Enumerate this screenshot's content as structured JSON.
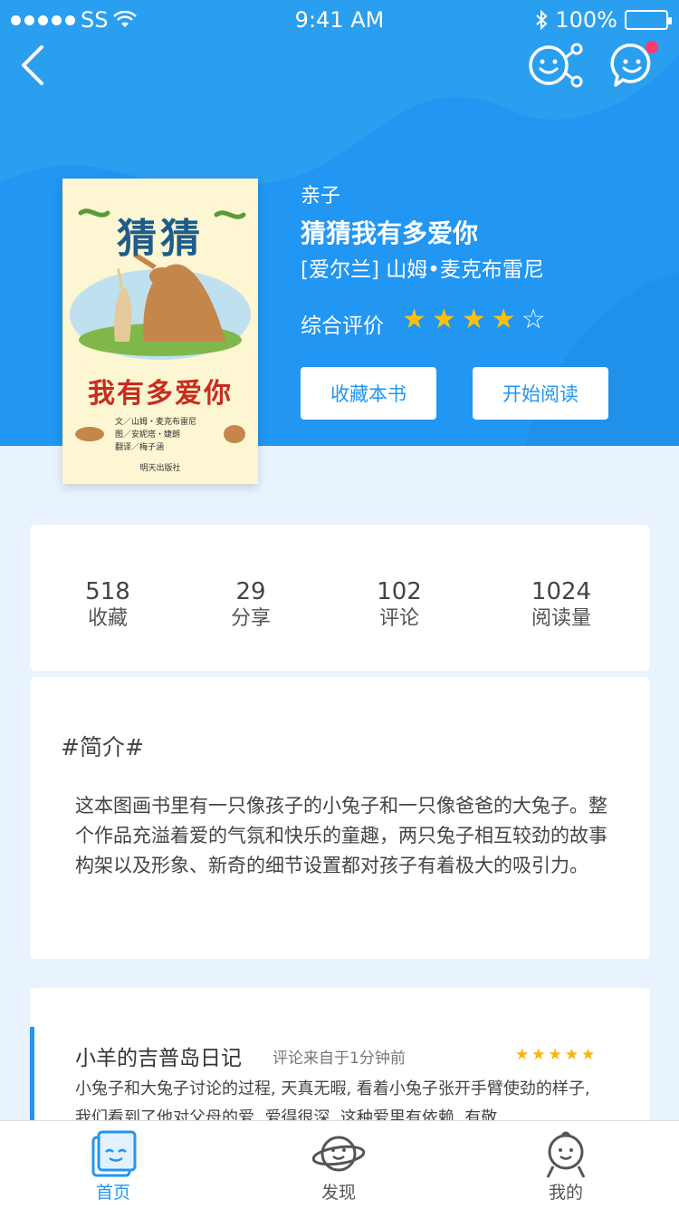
{
  "status_bar": {
    "carrier": "SS",
    "time": "9:41 AM",
    "battery": "100%"
  },
  "nav": {
    "back_icon": "back-chevron-icon",
    "share_icon": "share-face-icon",
    "message_icon": "message-face-icon",
    "badge_color": "#ff3b6b"
  },
  "book": {
    "category": "亲子",
    "title": "猜猜我有多爱你",
    "author": "[爱尔兰] 山姆•麦克布雷尼",
    "rating_label": "综合评价",
    "rating_value": 4,
    "rating_max": 5,
    "cover": {
      "title_top": "猜猜",
      "title_bottom": "我有多爱你",
      "credits": [
        "文／山姆・麦克布雷尼",
        "图／安妮塔・婕朗",
        "翻译／梅子涵"
      ],
      "publisher": "明天出版社"
    }
  },
  "buttons": {
    "favorite": "收藏本书",
    "read": "开始阅读"
  },
  "stats": [
    {
      "value": "518",
      "label": "收藏"
    },
    {
      "value": "29",
      "label": "分享"
    },
    {
      "value": "102",
      "label": "评论"
    },
    {
      "value": "1024",
      "label": "阅读量"
    }
  ],
  "intro": {
    "heading": "#简介#",
    "text": "这本图画书里有一只像孩子的小兔子和一只像爸爸的大兔子。整个作品充溢着爱的气氛和快乐的童趣，两只兔子相互较劲的故事构架以及形象、新奇的细节设置都对孩子有着极大的吸引力。"
  },
  "review": {
    "user": "小羊的吉普岛日记",
    "meta": "评论来自于1分钟前",
    "stars": 5,
    "text": "小兔子和大兔子讨论的过程, 天真无暇, 看着小兔子张开手臂使劲的样子, 我们看到了他对父母的爱, 爱得很深, 这种爱里有依赖, 有敬"
  },
  "tabs": [
    {
      "label": "首页",
      "icon": "book-home-icon",
      "active": true
    },
    {
      "label": "发现",
      "icon": "planet-face-icon",
      "active": false
    },
    {
      "label": "我的",
      "icon": "baby-face-icon",
      "active": false
    }
  ],
  "colors": {
    "primary": "#2196f3",
    "star": "#ffc107",
    "page_bg": "#e8f3fd"
  }
}
